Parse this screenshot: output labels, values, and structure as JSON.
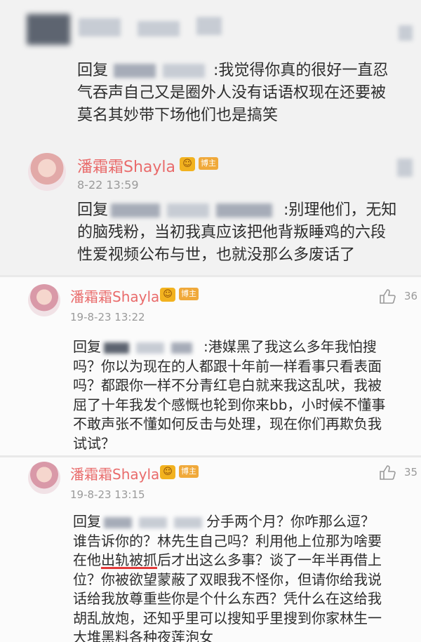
{
  "panel1": {
    "reply_prefix": "回复",
    "reply_text_l1": ":我觉得你真的很好一直忍",
    "reply_text_l2": "气吞声自己又是圈外人没有话语权现在还要被",
    "reply_text_l3": "莫名其妙带下场他们也是搞笑",
    "comment": {
      "name": "潘霜霜Shayla",
      "badge": "博主",
      "date": "8-22 13:59",
      "reply_prefix": "回复",
      "text_l1": ":别理他们，无知",
      "text_l2": "的脑残粉，当初我真应该把他背叛睡鸡的六段",
      "text_l3": "性爱视频公布与世，也就没那么多废话了"
    }
  },
  "panel2": {
    "name": "潘霜霜Shayla",
    "badge": "博主",
    "date": "19-8-23 13:22",
    "like_count": "36",
    "reply_prefix": "回复",
    "text_l1": ":港媒黑了我这么多年我怕搜",
    "text_l2": "吗？你以为现在的人都跟十年前一样看事只看表面",
    "text_l3": "吗？都跟你一样不分青红皂白就来我这乱吠，我被",
    "text_l4": "屈了十年我发个感慨也轮到你来bb，小时候不懂事",
    "text_l5": "不敢声张不懂如何反击与处理，现在你们再欺负我",
    "text_l6": "试试？"
  },
  "panel3": {
    "name": "潘霜霜Shayla",
    "badge": "博主",
    "date": "19-8-23 13:15",
    "like_count": "35",
    "reply_prefix": "回复",
    "text_l1": "分手两个月？你咋那么逗？",
    "text_l2": "谁告诉你的？林先生自己吗？利用他上位那为啥要",
    "text_l3_a": "在他",
    "text_l3_b": "出轨被抓",
    "text_l3_c": "后才出这么多事？谈了一年半再借上",
    "text_l4": "位？你被欲望蒙蔽了双眼我不怪你，但请你给我说",
    "text_l5": "话给我放尊重些你是个什么东西？凭什么在这给我",
    "text_l6": "胡乱放炮，还知乎里可以搜知乎里搜到你家林生一",
    "text_l7": "大堆黑料各种夜莲泡女"
  },
  "colors": {
    "name": "#e96b6b",
    "badge": "#f0a93a",
    "text": "#2d2d2d",
    "meta": "#9a9a9a"
  }
}
